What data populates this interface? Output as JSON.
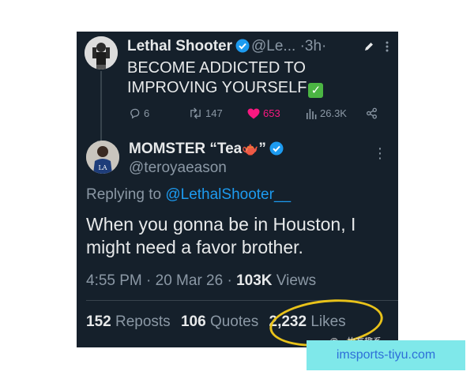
{
  "tweet1": {
    "name": "Lethal Shooter",
    "handle": "@Le...",
    "time": "·3h·",
    "text": "BECOME ADDICTED TO IMPROVING YOURSELF",
    "replies": "6",
    "reposts": "147",
    "likes": "653",
    "views": "26.3K"
  },
  "tweet2": {
    "name_prefix": "MOMSTER “Tea",
    "name_suffix": "”",
    "teapot_glyph": "🫖",
    "handle": "@teroyaeason",
    "more_glyph": "⋮",
    "replying_label": "Replying to",
    "replying_handle": "@LethalShooter__",
    "text": "When you gonna be in Houston, I might need a favor brother.",
    "meta": "4:55 PM · 20 Mar 26 ·",
    "views_count": "103K",
    "views_label": "Views",
    "reposts_count": "152",
    "reposts_label": "Reposts",
    "quotes_count": "106",
    "quotes_label": "Quotes",
    "likes_count": "2,232",
    "likes_label": "Likes"
  },
  "watermark_weibo": "@一枚有趣系",
  "banner_text": "imsports-tiyu.com",
  "colors": {
    "background": "#15202b",
    "text": "#e7e9ea",
    "muted": "#8b98a5",
    "link": "#1d9bf0",
    "like": "#f91880",
    "highlight_circle": "#e8c21a",
    "banner": "#7fe8ea"
  }
}
